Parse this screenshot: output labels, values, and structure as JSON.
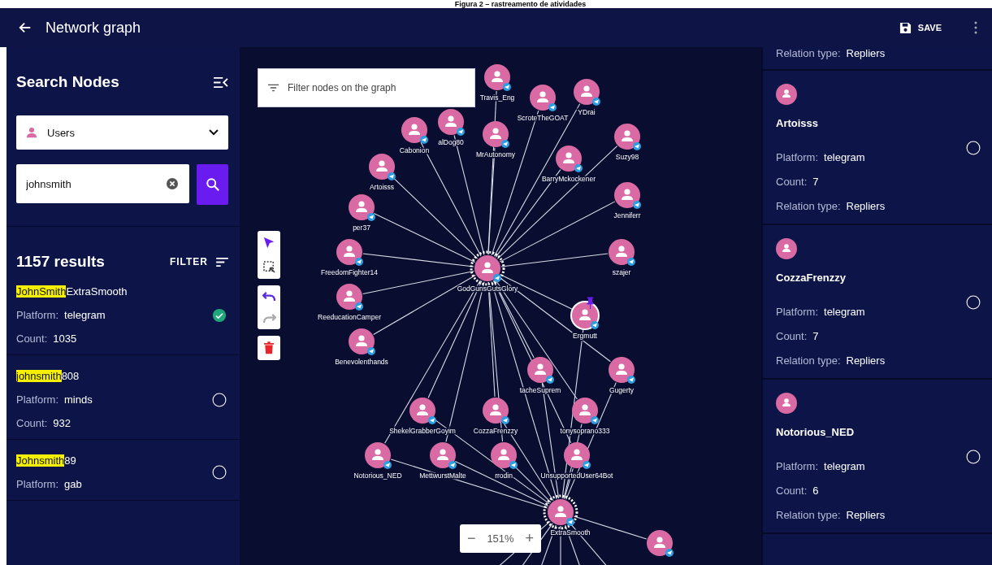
{
  "caption": "Figura 2 – rastreamento de atividades",
  "header": {
    "title": "Network graph",
    "save": "SAVE"
  },
  "search_panel": {
    "title": "Search Nodes",
    "type_select": "Users",
    "query": "johnsmith",
    "results_count": "1157 results",
    "filter": "FILTER",
    "results": [
      {
        "match": "JohnSmith",
        "rest": "ExtraSmooth",
        "platform_label": "Platform:",
        "platform": "telegram",
        "count_label": "Count:",
        "count": "1035",
        "selected": true
      },
      {
        "match": "johnsmith",
        "rest": "808",
        "platform_label": "Platform:",
        "platform": "minds",
        "count_label": "Count:",
        "count": "932",
        "selected": false
      },
      {
        "match": "Johnsmith",
        "rest": "89",
        "platform_label": "Platform:",
        "platform": "gab",
        "selected": false
      }
    ]
  },
  "graph": {
    "filter_placeholder": "Filter nodes on the graph",
    "tool_groups": [
      [
        {
          "kind": "pointer",
          "selected": true
        },
        {
          "kind": "marquee",
          "selected": false
        }
      ],
      [
        {
          "kind": "undo",
          "disabled": false
        },
        {
          "kind": "redo",
          "disabled": true
        }
      ],
      [
        {
          "kind": "delete",
          "disabled": false
        }
      ]
    ],
    "zoom": "151%",
    "zoom_out": "−",
    "zoom_in": "+",
    "nodes": [
      {
        "label": "alDog80",
        "pinned": false
      },
      {
        "label": "Travis_Eng",
        "pinned": false
      },
      {
        "label": "MrAutonomy",
        "pinned": false
      },
      {
        "label": "ScroteTheGOAT",
        "pinned": false
      },
      {
        "label": "YDrai",
        "pinned": false
      },
      {
        "label": "BarryMckockener",
        "pinned": false
      },
      {
        "label": "Suzy98",
        "pinned": false
      },
      {
        "label": "Jenniferr",
        "pinned": false
      },
      {
        "label": "szajer",
        "pinned": false
      },
      {
        "label": "Cabonion",
        "pinned": false
      },
      {
        "label": "Artoisss",
        "pinned": false
      },
      {
        "label": "per37",
        "pinned": false
      },
      {
        "label": "FreedomFighter14",
        "pinned": false
      },
      {
        "label": "ReeducationCamper",
        "pinned": false
      },
      {
        "label": "Benevolenthands",
        "pinned": false
      },
      {
        "label": "GodGunsGutsGlory",
        "pinned": false
      },
      {
        "label": "Ergmutt",
        "pinned": true
      },
      {
        "label": "tacheSuprem",
        "pinned": false
      },
      {
        "label": "Gugerty",
        "pinned": false
      },
      {
        "label": "ShekelGrabberGoyim",
        "pinned": false
      },
      {
        "label": "CozzaFrenzzy",
        "pinned": false
      },
      {
        "label": "tonysoprano333",
        "pinned": false
      },
      {
        "label": "Notorious_NED",
        "pinned": false
      },
      {
        "label": "MettwurstMalte",
        "pinned": false
      },
      {
        "label": "rrodin",
        "pinned": false
      },
      {
        "label": "UnsupportedUser64Bot",
        "pinned": false
      },
      {
        "label": "ExtraSmooth",
        "pinned": false
      },
      {
        "pinned": false
      }
    ]
  },
  "connections": [
    {
      "relation_label": "Relation type:",
      "relation": "Repliers"
    },
    {
      "name": "Artoisss",
      "platform_label": "Platform:",
      "platform": "telegram",
      "count_label": "Count:",
      "count": "7",
      "relation_label": "Relation type:",
      "relation": "Repliers",
      "selected": false
    },
    {
      "name": "CozzaFrenzzy",
      "platform_label": "Platform:",
      "platform": "telegram",
      "count_label": "Count:",
      "count": "7",
      "relation_label": "Relation type:",
      "relation": "Repliers",
      "selected": false
    },
    {
      "name": "Notorious_NED",
      "platform_label": "Platform:",
      "platform": "telegram",
      "count_label": "Count:",
      "count": "6",
      "relation_label": "Relation type:",
      "relation": "Repliers",
      "selected": false
    }
  ]
}
